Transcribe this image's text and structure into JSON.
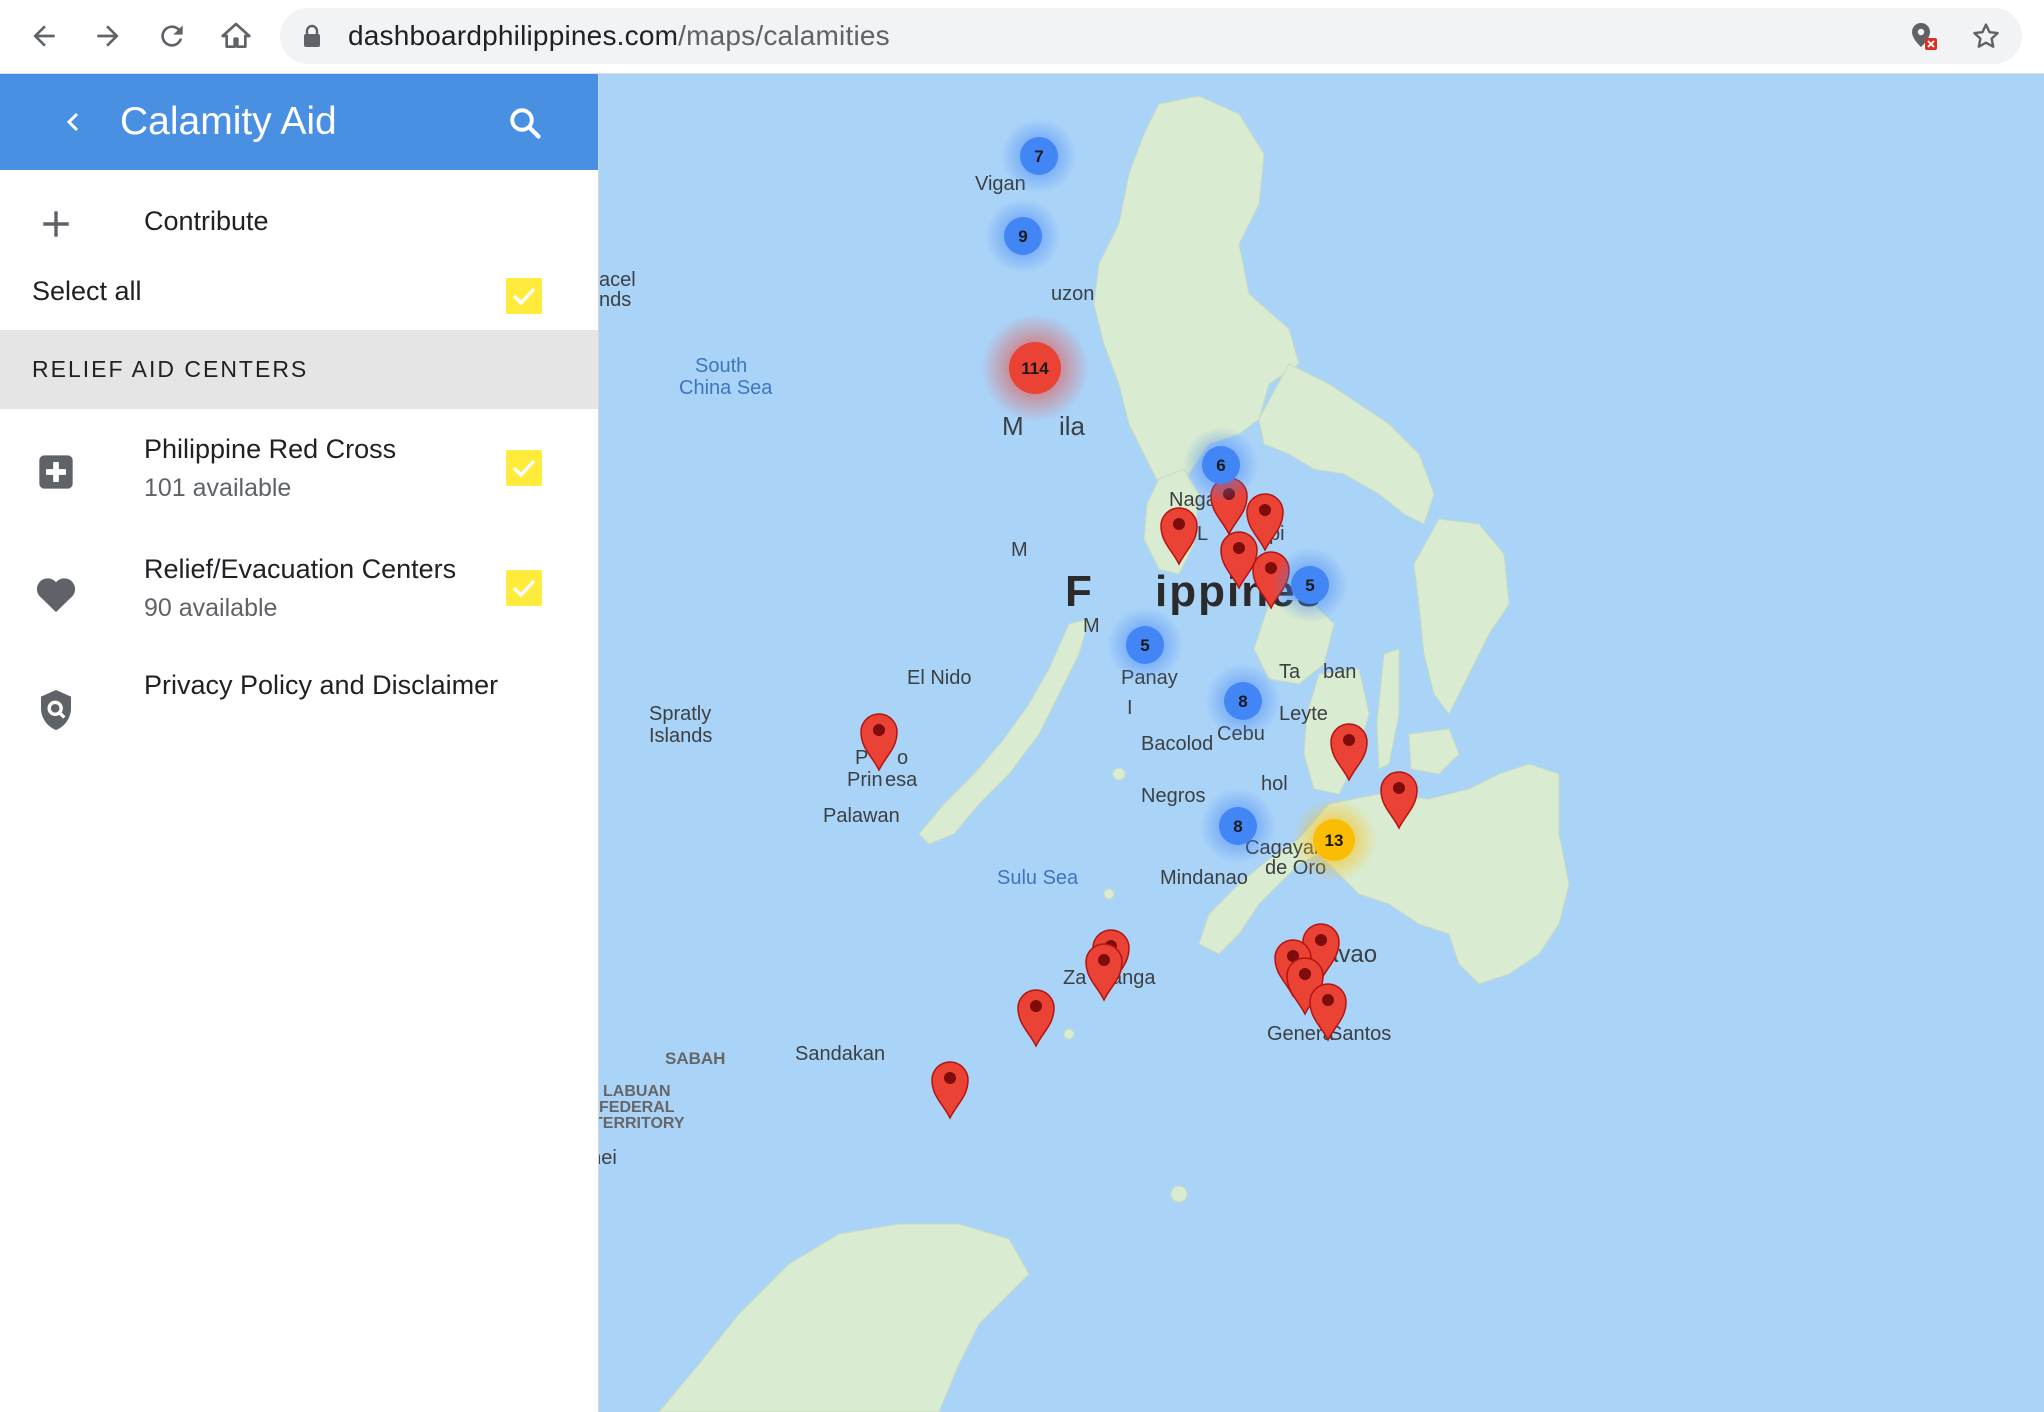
{
  "browser": {
    "url_host": "dashboardphilippines.com",
    "url_path": "/maps/calamities"
  },
  "sidebar": {
    "title": "Calamity Aid",
    "contribute": "Contribute",
    "select_all": "Select all",
    "section_title": "RELIEF AID CENTERS",
    "items": [
      {
        "label": "Philippine Red Cross",
        "sub": "101 available",
        "icon": "medical-cross-icon",
        "checked": true
      },
      {
        "label": "Relief/Evacuation Centers",
        "sub": "90 available",
        "icon": "heart-icon",
        "checked": true
      }
    ],
    "privacy": "Privacy Policy and Disclaimer"
  },
  "map": {
    "labels": {
      "vigan": "Vigan",
      "luzon": "uzon",
      "paracel1": "acel",
      "paracel2": "nds",
      "scs1": "South",
      "scs2": "China Sea",
      "manila": "M",
      "manila2": "ila",
      "naga": "Naga",
      "legazpi": "L",
      "legazpi2": "zpi",
      "mindoro": "M",
      "philippines": "F",
      "philippines2": "ippines",
      "malay": "M",
      "panay": "Panay",
      "tacloban1": "Ta",
      "tacloban2": "ban",
      "leyte": "Leyte",
      "elnido": "El Nido",
      "spratly1": "Spratly",
      "spratly2": "Islands",
      "puerto1": "P",
      "puerto1b": "o",
      "puerto2": "Prin",
      "puerto2b": "esa",
      "palawan": "Palawan",
      "iloilo": "I",
      "bacolod": "Bacolod",
      "cebu": "Cebu",
      "bohol": "hol",
      "negros": "Negros",
      "cagayan1": "Cagayan",
      "cagayan2": "de Oro",
      "sulu": "Sulu Sea",
      "mindanao": "Mindanao",
      "davao": "avao",
      "zamboanga1": "Za",
      "zamboanga2": "anga",
      "gensan1": "Genera",
      "gensan2": "Santos",
      "sabah": "SABAH",
      "sandakan": "Sandakan",
      "labuan1": "LABUAN",
      "labuan2": "FEDERAL",
      "labuan3": "TERRITORY",
      "brunei": "Brunei"
    },
    "clusters": [
      {
        "count": "7",
        "color": "#4285f4"
      },
      {
        "count": "9",
        "color": "#4285f4"
      },
      {
        "count": "114",
        "color": "#ea4335"
      },
      {
        "count": "6",
        "color": "#4285f4"
      },
      {
        "count": "5",
        "color": "#4285f4"
      },
      {
        "count": "5",
        "color": "#4285f4"
      },
      {
        "count": "8",
        "color": "#4285f4"
      },
      {
        "count": "8",
        "color": "#4285f4"
      },
      {
        "count": "13",
        "color": "#fbbc04"
      }
    ],
    "pin_color": "#ea4335",
    "water_color": "#aad3f8",
    "land_color": "#d9ebd0"
  }
}
